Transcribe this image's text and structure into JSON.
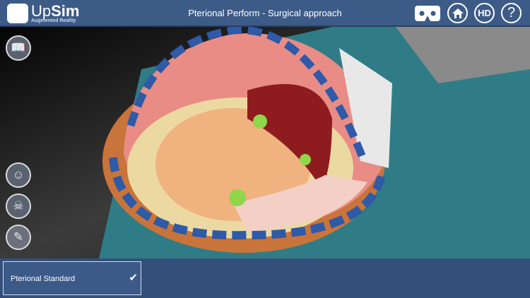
{
  "header": {
    "logo_name": "UpSim",
    "logo_prefix": "Up",
    "logo_suffix": "Sim",
    "logo_subtitle": "Augmented Reality",
    "title": "Pterional Perform - Surgical approach",
    "buttons": {
      "hd": "HD",
      "help": "?"
    }
  },
  "sidebar": {
    "icons": [
      "book-icon",
      "brain-head-icon",
      "skull-icon",
      "scalpel-icon"
    ]
  },
  "bottom": {
    "options": [
      {
        "label": "Pterional Standard",
        "selected": true
      }
    ]
  },
  "colors": {
    "header": "#3d5b87",
    "bottom": "#34507a",
    "drape": "#2f7c86"
  }
}
